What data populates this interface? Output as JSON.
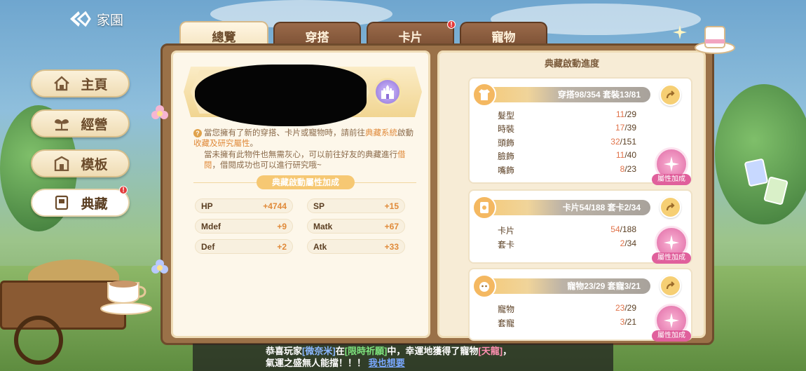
{
  "home": {
    "title": "家園"
  },
  "sidebar": {
    "items": [
      {
        "label": "主頁",
        "icon": "house-icon"
      },
      {
        "label": "經營",
        "icon": "sprout-icon"
      },
      {
        "label": "模板",
        "icon": "building-icon"
      },
      {
        "label": "典藏",
        "icon": "book-icon",
        "alert": "!"
      }
    ]
  },
  "tabs": [
    {
      "label": "總覽",
      "active": true
    },
    {
      "label": "穿搭",
      "active": false
    },
    {
      "label": "卡片",
      "active": false,
      "alert": "!"
    },
    {
      "label": "寵物",
      "active": false
    }
  ],
  "overview": {
    "info_q": "?",
    "info_1_a": "當您擁有了新的穿搭、卡片或寵物時，請前往",
    "info_1_hl1": "典藏系統",
    "info_1_b": "啟動",
    "info_1_hl2": "收藏及研究屬性",
    "info_1_c": "。",
    "info_2_a": "當未擁有此物件也無需灰心，可以前往好友的典藏進行",
    "info_2_hl": "借閱",
    "info_2_b": "，借閱成功也可以進行研究哦~",
    "attr_title": "典藏啟動屬性加成",
    "attrs": [
      {
        "k": "HP",
        "v": "+4744"
      },
      {
        "k": "SP",
        "v": "+15"
      },
      {
        "k": "Mdef",
        "v": "+9"
      },
      {
        "k": "Matk",
        "v": "+67"
      },
      {
        "k": "Def",
        "v": "+2"
      },
      {
        "k": "Atk",
        "v": "+33"
      }
    ]
  },
  "progress": {
    "title": "典藏啟動進度",
    "bonus_label": "屬性加成",
    "outfit": {
      "head": "穿搭98/354  套裝13/81",
      "rows": [
        {
          "k": "髮型",
          "v": "11",
          "t": "/29"
        },
        {
          "k": "時裝",
          "v": "17",
          "t": "/39"
        },
        {
          "k": "頭飾",
          "v": "32",
          "t": "/151"
        },
        {
          "k": "臉飾",
          "v": "11",
          "t": "/40"
        },
        {
          "k": "嘴飾",
          "v": "8",
          "t": "/23"
        }
      ]
    },
    "cards": {
      "head": "卡片54/188  套卡2/34",
      "rows": [
        {
          "k": "卡片",
          "v": "54",
          "t": "/188"
        },
        {
          "k": "套卡",
          "v": "2",
          "t": "/34"
        }
      ]
    },
    "pets": {
      "head": "寵物23/29  套寵3/21",
      "rows": [
        {
          "k": "寵物",
          "v": "23",
          "t": "/29"
        },
        {
          "k": "套寵",
          "v": "3",
          "t": "/21"
        }
      ]
    }
  },
  "marquee": {
    "p1": "恭喜玩家",
    "name": "[微奈米]",
    "p2": "在",
    "event": "[限時祈願]",
    "p3": "中，幸運地獲得了寵物",
    "pet": "[天龍]",
    "p4": "，",
    "line2": "氣運之盛無人能擋！！！",
    "link": "我也想要"
  }
}
